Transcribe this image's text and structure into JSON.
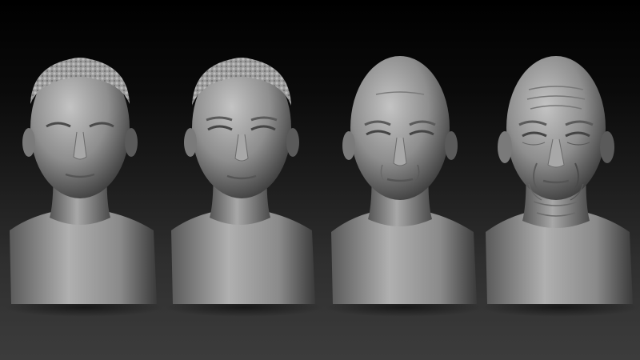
{
  "scene": {
    "background_top": "#000000",
    "background_bottom": "#3c3c3c",
    "clay_color": "#8e8e8e",
    "clay_highlight": "#c4c4c4",
    "clay_shadow": "#3a3a3a"
  },
  "busts": [
    {
      "id": "bust-young",
      "hair": "short-textured",
      "age_stage": 1,
      "wrinkles": 0
    },
    {
      "id": "bust-young-adult",
      "hair": "short-textured",
      "age_stage": 2,
      "wrinkles": 0
    },
    {
      "id": "bust-middle-aged",
      "hair": "bald",
      "age_stage": 3,
      "wrinkles": 1
    },
    {
      "id": "bust-elderly",
      "hair": "bald",
      "age_stage": 4,
      "wrinkles": 2
    }
  ]
}
